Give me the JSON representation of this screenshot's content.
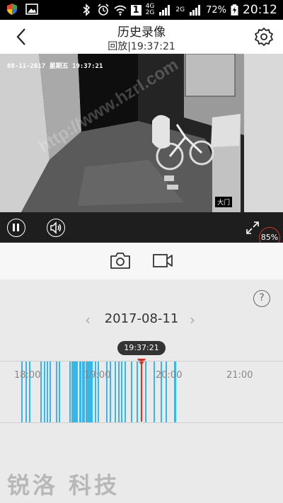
{
  "status_bar": {
    "network_4g": "4G",
    "network_2g": "2G",
    "sim_2g": "2G",
    "sim_badge": "1",
    "battery_pct": "72%",
    "time": "20:12"
  },
  "header": {
    "title": "历史录像",
    "subtitle": "回放|19:37:21"
  },
  "video": {
    "osd": "08-11-2017 星期五 19:37:21",
    "door_label": "大门",
    "watermark": "http://www.hzrl.com"
  },
  "controls": {
    "zoom_pct": "85%"
  },
  "timeline": {
    "help": "?",
    "prev": "‹",
    "next": "›",
    "date": "2017-08-11",
    "current_time": "19:37:21",
    "ticks": [
      "18:00",
      "19:00",
      "20:00",
      "21:00"
    ]
  },
  "branding": {
    "logo_text": "锐洛 科技"
  },
  "colors": {
    "accent": "#d0342c",
    "segment": "#38b6e8"
  }
}
